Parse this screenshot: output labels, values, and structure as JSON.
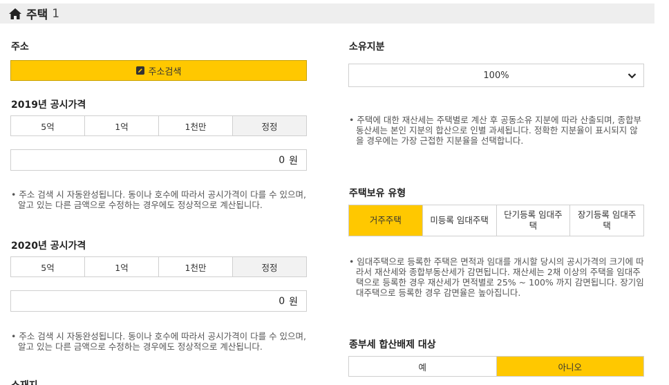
{
  "header": {
    "title": "주택",
    "number": "1",
    "icon": "home-icon"
  },
  "address": {
    "label": "주소",
    "search_button": "주소검색",
    "icon": "edit-icon"
  },
  "price2019": {
    "label": "2019년 공시가격",
    "buttons": [
      "5억",
      "1억",
      "1천만",
      "정정"
    ],
    "value": "0",
    "unit": "원",
    "note": "• 주소 검색 시 자동완성됩니다. 동이나 호수에 따라서 공시가격이 다를 수 있으며, 알고 있는 다른 금액으로 수정하는 경우에도 정상적으로 계산됩니다."
  },
  "price2020": {
    "label": "2020년 공시가격",
    "buttons": [
      "5억",
      "1억",
      "1천만",
      "정정"
    ],
    "value": "0",
    "unit": "원",
    "note": "• 주소 검색 시 자동완성됩니다. 동이나 호수에 따라서 공시가격이 다를 수 있으며, 알고 있는 다른 금액으로 수정하는 경우에도 정상적으로 계산됩니다."
  },
  "next_section_label": "소재지",
  "ownership": {
    "label": "소유지분",
    "selected": "100%",
    "note": "• 주택에 대한 재산세는 주택별로 계산 후 공동소유 지분에 따라 산출되며, 종합부동산세는 본인 지분의 합산으로 인별 과세됩니다. 정확한 지분율이 표시되지 않을 경우에는 가장 근접한 지분율을 선택합니다."
  },
  "housing_type": {
    "label": "주택보유 유형",
    "options": [
      "거주주택",
      "미등록 임대주택",
      "단기등록 임대주택",
      "장기등록 임대주택"
    ],
    "active_index": 0,
    "note": "• 임대주택으로 등록한 주택은 면적과 임대를 개시할 당시의 공시가격의 크기에 따라서 재산세와 종합부동산세가 감면됩니다. 재산세는 2채 이상의 주택을 임대주택으로 등록한 경우 재산세가 면적별로 25% ~ 100% 까지 감면됩니다. 장기임대주택으로 등록한 경우 감면율은 높아집니다."
  },
  "exclusion": {
    "label": "종부세 합산배제 대상",
    "options": [
      "예",
      "아니오"
    ],
    "active_index": 1
  },
  "colors": {
    "accent": "#ffc800",
    "header_bg": "#eeeeee",
    "border": "#cfcfcf"
  }
}
